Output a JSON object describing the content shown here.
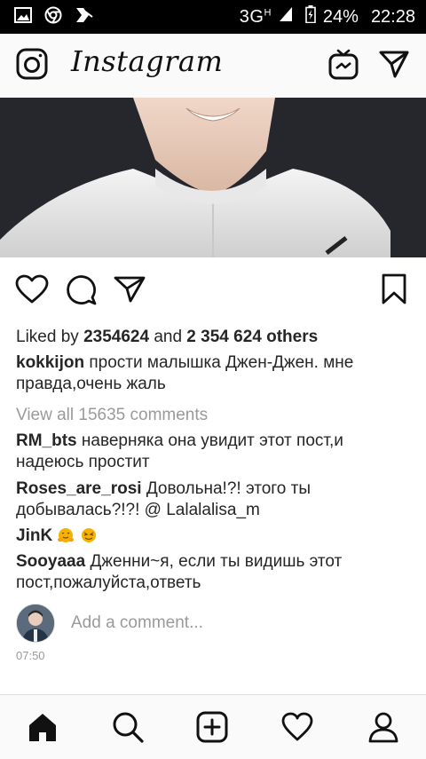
{
  "status_bar": {
    "network": "3G",
    "network_sup": "H",
    "battery": "24%",
    "time": "22:28",
    "icons": [
      "gallery-icon",
      "chrome-icon",
      "vpn-icon",
      "signal-icon",
      "battery-icon"
    ]
  },
  "app": {
    "title": "Instagram",
    "header_icons": [
      "camera-icon",
      "igtv-icon",
      "direct-message-icon"
    ]
  },
  "post": {
    "likes_prefix": "Liked by",
    "likes_user": "2354624",
    "likes_mid": "and",
    "likes_others": "2 354 624 others",
    "caption_user": "kokkijon",
    "caption_text": "прости малышка Джен-Джен. мне правда,очень жаль",
    "view_all": "View all 15635 comments",
    "comments": [
      {
        "user": "RM_bts",
        "text": "наверняка она увидит этот пост,и надеюсь простит"
      },
      {
        "user": "Roses_are_rosi",
        "text": "Довольна!?! этого ты добывалась?!?! @ Lalalalisa_m"
      },
      {
        "user": "JinK",
        "text": ""
      },
      {
        "user": "Sooyaaa",
        "text": "Дженни~я, если ты видишь этот пост,пожалуйста,ответь"
      }
    ],
    "add_comment_placeholder": "Add a comment...",
    "time": "07:50"
  },
  "nav": {
    "items": [
      "home-icon",
      "search-icon",
      "new-post-icon",
      "activity-icon",
      "profile-icon"
    ]
  },
  "colors": {
    "status_bg": "#000000",
    "header_bg": "#fafafa",
    "text": "#262626",
    "muted": "#9a9a9a",
    "emoji": "#f5b300"
  }
}
